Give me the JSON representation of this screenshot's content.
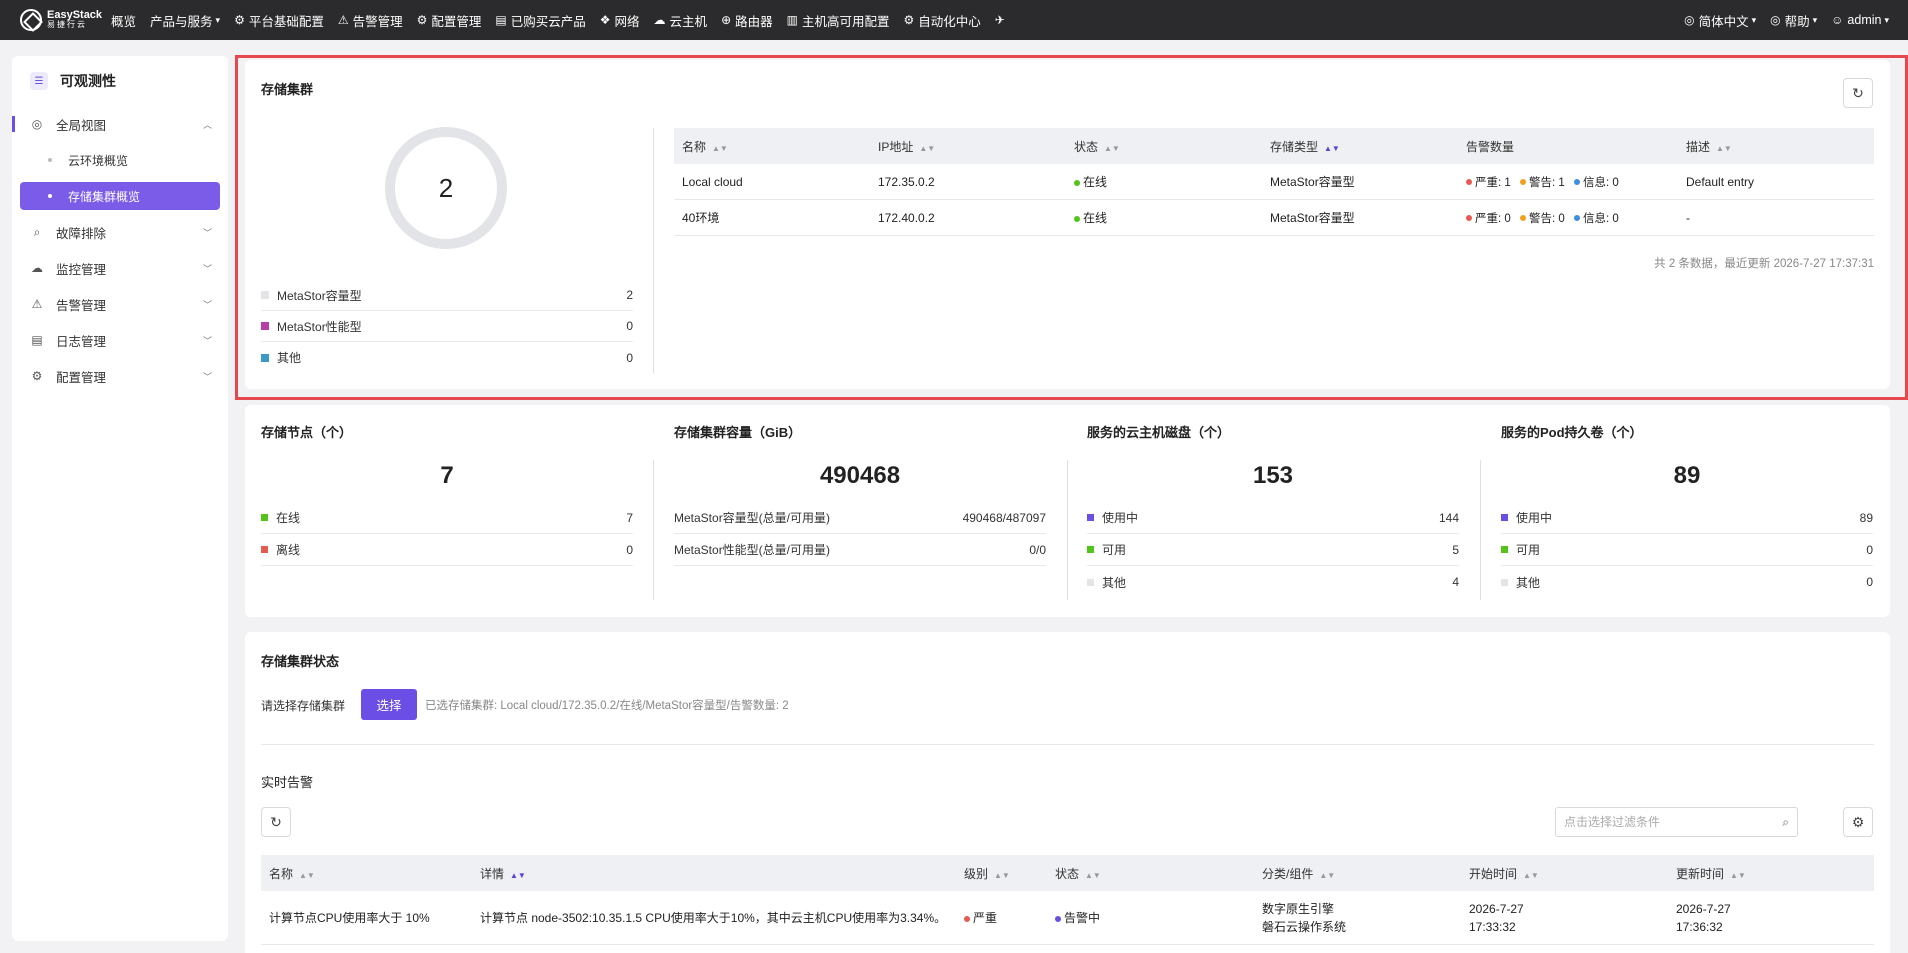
{
  "topbar": {
    "logo_line1": "EasyStack",
    "logo_line2": "易捷行云",
    "nav": [
      {
        "label": "概览",
        "icon": ""
      },
      {
        "label": "产品与服务",
        "icon": "",
        "caret": "▾"
      },
      {
        "label": "平台基础配置",
        "icon": "⚙"
      },
      {
        "label": "告警管理",
        "icon": "⚠"
      },
      {
        "label": "配置管理",
        "icon": "⚙"
      },
      {
        "label": "已购买云产品",
        "icon": "▤"
      },
      {
        "label": "网络",
        "icon": "❖"
      },
      {
        "label": "云主机",
        "icon": "☁"
      },
      {
        "label": "路由器",
        "icon": "⊕"
      },
      {
        "label": "主机高可用配置",
        "icon": "▥"
      },
      {
        "label": "自动化中心",
        "icon": "⚙"
      },
      {
        "label": "",
        "icon": "✈"
      }
    ],
    "language": "简体中文",
    "help": "帮助",
    "user": "admin"
  },
  "sidebar": {
    "title": "可观测性",
    "items": [
      {
        "label": "全局视图",
        "icon": "globe-icon",
        "open": true,
        "subs": [
          "云环境概览",
          "存储集群概览"
        ]
      },
      {
        "label": "故障排除",
        "icon": "search-icon"
      },
      {
        "label": "监控管理",
        "icon": "monitor-icon"
      },
      {
        "label": "告警管理",
        "icon": "alarm-icon"
      },
      {
        "label": "日志管理",
        "icon": "log-icon"
      },
      {
        "label": "配置管理",
        "icon": "gear-icon"
      }
    ]
  },
  "cluster": {
    "title": "存储集群",
    "total": "2",
    "legend": [
      {
        "label": "MetaStor容量型",
        "value": "2",
        "color": "#e3e4e8"
      },
      {
        "label": "MetaStor性能型",
        "value": "0",
        "color": "#b83fa6"
      },
      {
        "label": "其他",
        "value": "0",
        "color": "#3b9bc4"
      }
    ],
    "columns": [
      "名称",
      "IP地址",
      "状态",
      "存储类型",
      "告警数量",
      "描述"
    ],
    "rows": [
      {
        "name": "Local cloud",
        "ip": "172.35.0.2",
        "status": "在线",
        "type": "MetaStor容量型",
        "severe": "严重: 1",
        "warn": "警告: 1",
        "info": "信息: 0",
        "desc": "Default entry"
      },
      {
        "name": "40环境",
        "ip": "172.40.0.2",
        "status": "在线",
        "type": "MetaStor容量型",
        "severe": "严重: 0",
        "warn": "警告: 0",
        "info": "信息: 0",
        "desc": "-"
      }
    ],
    "footer": "共 2 条数据，最近更新  2026-7-27 17:37:31"
  },
  "stats": [
    {
      "title": "存储节点（个）",
      "value": "7",
      "rows": [
        {
          "label": "在线",
          "value": "7",
          "color": "#52c41a"
        },
        {
          "label": "离线",
          "value": "0",
          "color": "#e55b50"
        }
      ]
    },
    {
      "title": "存储集群容量（GiB）",
      "value": "490468",
      "rows": [
        {
          "label": "MetaStor容量型(总量/可用量)",
          "value": "490468/487097",
          "color": ""
        },
        {
          "label": "MetaStor性能型(总量/可用量)",
          "value": "0/0",
          "color": ""
        }
      ]
    },
    {
      "title": "服务的云主机磁盘（个）",
      "value": "153",
      "rows": [
        {
          "label": "使用中",
          "value": "144",
          "color": "#6b4ee6"
        },
        {
          "label": "可用",
          "value": "5",
          "color": "#52c41a"
        },
        {
          "label": "其他",
          "value": "4",
          "color": "#e3e4e8"
        }
      ]
    },
    {
      "title": "服务的Pod持久卷（个）",
      "value": "89",
      "rows": [
        {
          "label": "使用中",
          "value": "89",
          "color": "#6b4ee6"
        },
        {
          "label": "可用",
          "value": "0",
          "color": "#52c41a"
        },
        {
          "label": "其他",
          "value": "0",
          "color": "#e3e4e8"
        }
      ]
    }
  ],
  "status_section": {
    "title": "存储集群状态",
    "select_label": "请选择存储集群",
    "select_button": "选择",
    "selected_text": "已选存储集群:  Local cloud/172.35.0.2/在线/MetaStor容量型/告警数量: 2",
    "alerts_title": "实时告警",
    "filter_placeholder": "点击选择过滤条件",
    "columns": [
      "名称",
      "详情",
      "级别",
      "状态",
      "分类/组件",
      "开始时间",
      "更新时间"
    ],
    "rows": [
      {
        "name": "计算节点CPU使用率大于 10%",
        "detail": "计算节点 node-3502:10.35.1.5 CPU使用率大于10%，其中云主机CPU使用率为3.34%。",
        "level": "严重",
        "state": "告警中",
        "category1": "数字原生引擎",
        "category2": "磐石云操作系统",
        "start1": "2026-7-27",
        "start2": "17:33:32",
        "update1": "2026-7-27",
        "update2": "17:36:32"
      }
    ]
  }
}
